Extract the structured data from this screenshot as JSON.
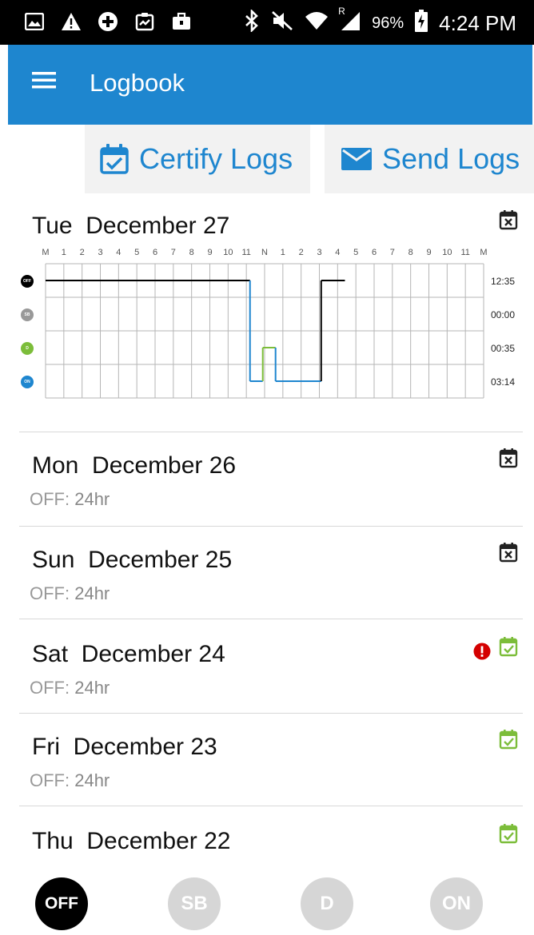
{
  "status_bar": {
    "battery": "96%",
    "time": "4:24 PM",
    "roaming_indicator": "R",
    "left_icons": [
      "image-icon",
      "warning-icon",
      "plus-circle-icon",
      "clipboard-icon",
      "briefcase-icon"
    ],
    "right_icons": [
      "bluetooth-icon",
      "mute-icon",
      "wifi-icon",
      "signal-icon",
      "battery-charging-icon"
    ]
  },
  "app_bar": {
    "title": "Logbook",
    "color": "#1e86cf"
  },
  "actions": {
    "certify_label": "Certify Logs",
    "send_label": "Send Logs"
  },
  "today": {
    "day": "Tue",
    "date": "December 27",
    "hour_labels": [
      "M",
      "1",
      "2",
      "3",
      "4",
      "5",
      "6",
      "7",
      "8",
      "9",
      "10",
      "11",
      "N",
      "1",
      "2",
      "3",
      "4",
      "5",
      "6",
      "7",
      "8",
      "9",
      "10",
      "11",
      "M"
    ],
    "statuses": [
      {
        "code": "OFF",
        "total": "12:35",
        "color": "#000000"
      },
      {
        "code": "SB",
        "total": "00:00",
        "color": "#999999"
      },
      {
        "code": "D",
        "total": "00:35",
        "color": "#7cbd3a"
      },
      {
        "code": "ON",
        "total": "03:14",
        "color": "#1e86cf"
      }
    ],
    "segments": [
      {
        "status": 0,
        "start": 0.0,
        "end": 11.2
      },
      {
        "status": 3,
        "start": 11.2,
        "end": 11.9
      },
      {
        "status": 2,
        "start": 11.9,
        "end": 12.6
      },
      {
        "status": 3,
        "start": 12.6,
        "end": 15.1
      },
      {
        "status": 0,
        "start": 15.1,
        "end": 16.4
      }
    ],
    "cert_icon": "calendar-x-icon"
  },
  "days": [
    {
      "day": "Mon",
      "date": "December 26",
      "status_label": "OFF:",
      "status_value": " 24hr",
      "cert_icon": "calendar-x-icon",
      "alert": false
    },
    {
      "day": "Sun",
      "date": "December 25",
      "status_label": "OFF:",
      "status_value": " 24hr",
      "cert_icon": "calendar-x-icon",
      "alert": false
    },
    {
      "day": "Sat",
      "date": "December 24",
      "status_label": "OFF:",
      "status_value": " 24hr",
      "cert_icon": "calendar-check-icon",
      "alert": true
    },
    {
      "day": "Fri",
      "date": "December 23",
      "status_label": "OFF:",
      "status_value": " 24hr",
      "cert_icon": "calendar-check-icon",
      "alert": false
    },
    {
      "day": "Thu",
      "date": "December 22",
      "cert_icon": "calendar-check-icon",
      "alert": false
    }
  ],
  "status_buttons": [
    {
      "label": "OFF",
      "active": true
    },
    {
      "label": "SB",
      "active": false
    },
    {
      "label": "D",
      "active": false
    },
    {
      "label": "ON",
      "active": false
    }
  ]
}
